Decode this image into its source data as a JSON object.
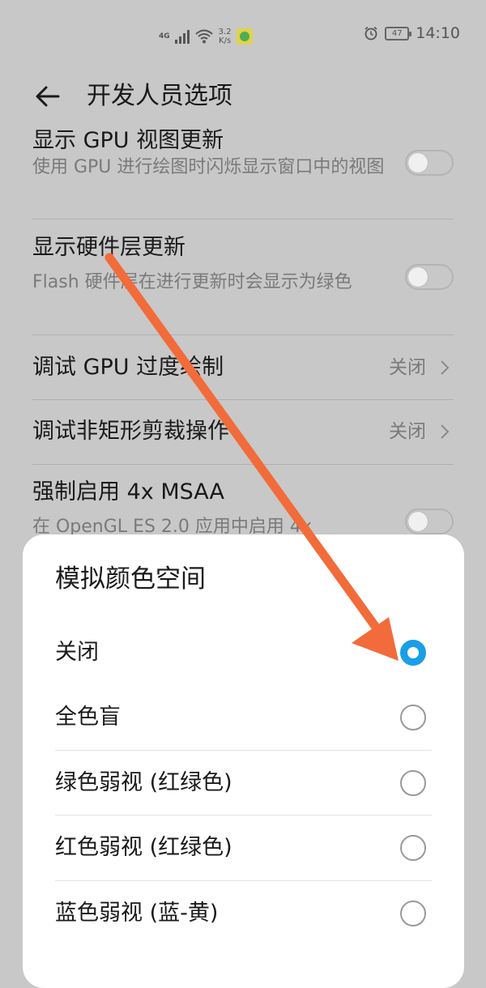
{
  "status_bar": {
    "network": "4G",
    "speed_value": "3.2",
    "speed_unit": "K/s",
    "battery": "47",
    "time": "14:10",
    "icons": [
      "signal-icon",
      "wifi-icon",
      "app-notification-icon",
      "alarm-icon",
      "battery-icon"
    ]
  },
  "header": {
    "title": "开发人员选项",
    "back_icon": "back-arrow-icon"
  },
  "settings": [
    {
      "title": "显示 GPU 视图更新",
      "desc": "使用 GPU 进行绘图时闪烁显示窗口中的视图",
      "control": "toggle",
      "enabled": false
    },
    {
      "title": "显示硬件层更新",
      "desc": "Flash 硬件层在进行更新时会显示为绿色",
      "control": "toggle",
      "enabled": false
    },
    {
      "title": "调试 GPU 过度绘制",
      "value": "关闭",
      "control": "chevron"
    },
    {
      "title": "调试非矩形剪裁操作",
      "value": "关闭",
      "control": "chevron"
    },
    {
      "title": "强制启用 4x MSAA",
      "desc": "在 OpenGL ES 2.0 应用中启用 4x",
      "control": "toggle",
      "enabled": false
    }
  ],
  "dialog": {
    "title": "模拟颜色空间",
    "options": [
      {
        "label": "关闭",
        "selected": true
      },
      {
        "label": "全色盲",
        "selected": false
      },
      {
        "label": "绿色弱视 (红绿色)",
        "selected": false
      },
      {
        "label": "红色弱视 (红绿色)",
        "selected": false
      },
      {
        "label": "蓝色弱视 (蓝-黄)",
        "selected": false
      }
    ]
  },
  "colors": {
    "overlay_background": "#c8c8c8",
    "radio_selected": "#1a9ee8",
    "annotation_arrow": "#f26b3a"
  }
}
